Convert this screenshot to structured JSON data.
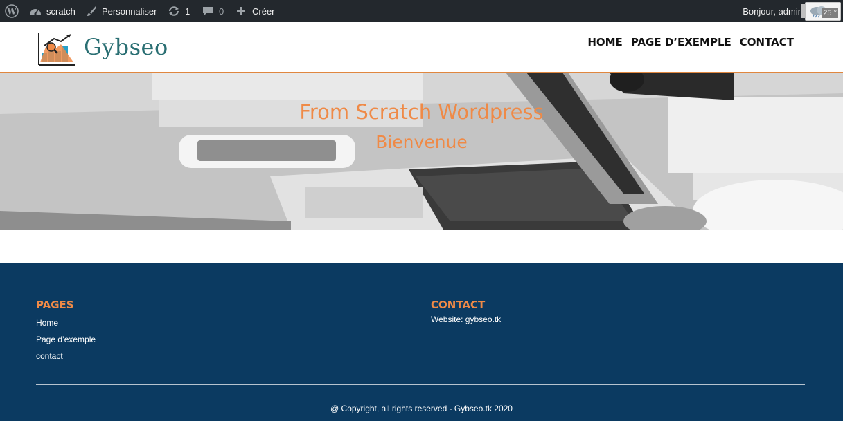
{
  "admin_bar": {
    "site_name": "scratch",
    "customize": "Personnaliser",
    "updates_count": "1",
    "comments_count": "0",
    "new_label": "Créer",
    "greeting": "Bonjour, admin",
    "weather_temp": "25 °"
  },
  "header": {
    "logo_text": "Gybseo",
    "nav": [
      "HOME",
      "PAGE D’EXEMPLE",
      "CONTACT"
    ]
  },
  "hero": {
    "title": "From Scratch Wordpress",
    "subtitle": "Bienvenue"
  },
  "footer": {
    "pages_heading": "PAGES",
    "pages_links": [
      "Home",
      "Page d’exemple",
      "contact"
    ],
    "contact_heading": "CONTACT",
    "contact_text": "Website: gybseo.tk",
    "copyright": "@ Copyright, all rights reserved - Gybseo.tk 2020"
  },
  "colors": {
    "admin_bar_bg": "#23282d",
    "accent_orange": "#ef8a47",
    "logo_teal": "#2a6f73",
    "footer_bg": "#0b3a61"
  }
}
